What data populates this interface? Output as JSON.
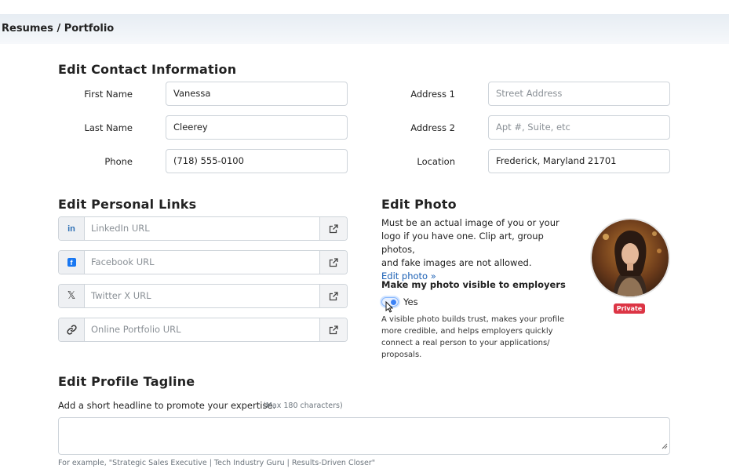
{
  "breadcrumb": "Resumes / Portfolio",
  "contact": {
    "heading": "Edit Contact Information",
    "fields": {
      "first_name": {
        "label": "First Name",
        "value": "Vanessa"
      },
      "last_name": {
        "label": "Last Name",
        "value": "Cleerey"
      },
      "phone": {
        "label": "Phone",
        "value": "(718) 555-0100"
      },
      "address1": {
        "label": "Address 1",
        "placeholder": "Street Address"
      },
      "address2": {
        "label": "Address 2",
        "placeholder": "Apt #, Suite, etc"
      },
      "location": {
        "label": "Location",
        "value": "Frederick, Maryland 21701"
      }
    }
  },
  "links": {
    "heading": "Edit Personal Links",
    "items": [
      {
        "icon": "linkedin-icon",
        "placeholder": "LinkedIn URL"
      },
      {
        "icon": "facebook-icon",
        "placeholder": "Facebook URL"
      },
      {
        "icon": "x-twitter-icon",
        "placeholder": "Twitter X URL"
      },
      {
        "icon": "link-icon",
        "placeholder": "Online Portfolio URL"
      }
    ],
    "open_icon": "external-link-icon"
  },
  "photo": {
    "heading": "Edit Photo",
    "description_lines": [
      "Must be an actual image of you or your",
      "logo if you have one. Clip art, group photos,",
      "and fake images are not allowed."
    ],
    "edit_link": "Edit photo »",
    "visibility_label": "Make my photo visible to employers",
    "toggle_label": "Yes",
    "toggle_on": true,
    "note_lines": [
      "A visible photo builds trust, makes your profile",
      "more credible, and helps employers quickly",
      "connect a real person to your applications/",
      "proposals."
    ],
    "badge": "Private",
    "badge_color": "#dc3545"
  },
  "tagline": {
    "heading": "Edit Profile Tagline",
    "prompt": "Add a short headline to promote your expertise.",
    "limit": "(Max 180 characters)",
    "value": "",
    "example": "For example, \"Strategic Sales Executive | Tech Industry Guru | Results-Driven Closer\""
  },
  "colors": {
    "link": "#1a5fb4",
    "linkedin": "#2d6fb4",
    "facebook": "#1877f2"
  }
}
